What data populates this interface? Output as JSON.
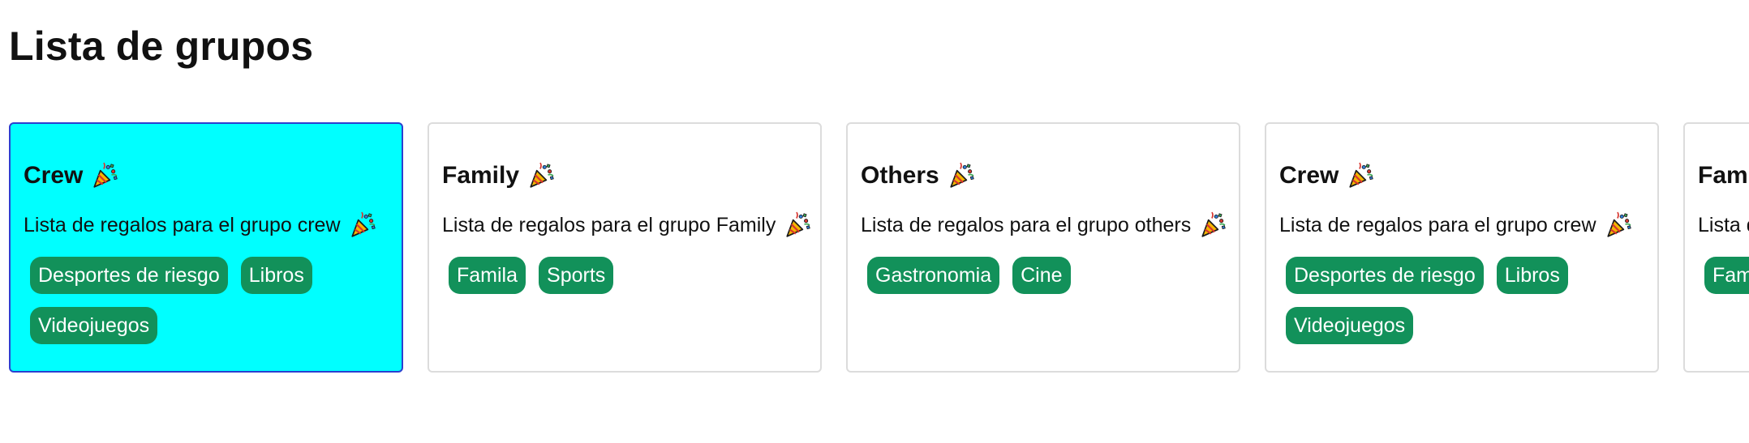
{
  "page": {
    "title": "Lista de grupos"
  },
  "groups": [
    {
      "name": "Crew",
      "description": "Lista de regalos para el grupo crew",
      "tags": [
        "Desportes de riesgo",
        "Libros",
        "Videojuegos"
      ],
      "selected": true
    },
    {
      "name": "Family",
      "description": "Lista de regalos para el grupo Family",
      "tags": [
        "Famila",
        "Sports"
      ],
      "selected": false
    },
    {
      "name": "Others",
      "description": "Lista de regalos para el grupo others",
      "tags": [
        "Gastronomia",
        "Cine"
      ],
      "selected": false
    },
    {
      "name": "Crew",
      "description": "Lista de regalos para el grupo crew",
      "tags": [
        "Desportes de riesgo",
        "Libros",
        "Videojuegos"
      ],
      "selected": false
    },
    {
      "name": "Family",
      "description": "Lista de regalos para el grupo Family",
      "tags": [
        "Famila"
      ],
      "selected": false
    }
  ],
  "icons": {
    "title_icon": "party-popper-icon",
    "description_icon": "party-popper-icon"
  },
  "colors": {
    "selected_card_bg": "#00ffff",
    "selected_card_border": "#2b3fd0",
    "tag_bg": "#12915a",
    "tag_text": "#ffffff",
    "card_border": "#dcdcdc"
  }
}
